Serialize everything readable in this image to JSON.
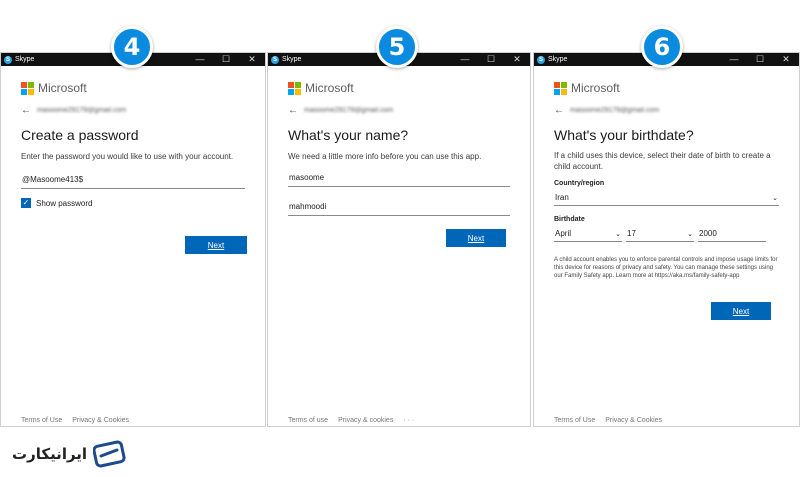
{
  "app": {
    "title": "Skype",
    "logo_letter": "S"
  },
  "window_controls": {
    "minimize": "—",
    "maximize": "☐",
    "close": "✕"
  },
  "brand": {
    "microsoft": "Microsoft",
    "colors": [
      "#f25022",
      "#7fba00",
      "#00a4ef",
      "#ffb900"
    ]
  },
  "email": "masoome29179@gmail.com",
  "steps": [
    "4",
    "5",
    "6"
  ],
  "panel1": {
    "heading": "Create a password",
    "description": "Enter the password you would like to use with your account.",
    "password_value": "@Masoome413$",
    "show_password_label": "Show password",
    "next_label": "Next",
    "footer": {
      "terms": "Terms of Use",
      "privacy": "Privacy & Cookies"
    }
  },
  "panel2": {
    "heading": "What's your name?",
    "description": "We need a little more info before you can use this app.",
    "first_name": "masoome",
    "last_name": "mahmoodi",
    "next_label": "Next",
    "footer": {
      "terms": "Terms of use",
      "privacy": "Privacy & cookies",
      "more": "· · ·"
    }
  },
  "panel3": {
    "heading": "What's your birthdate?",
    "description": "If a child uses this device, select their date of birth to create a child account.",
    "country_label": "Country/region",
    "country_value": "Iran",
    "birthdate_label": "Birthdate",
    "month": "April",
    "day": "17",
    "year": "2000",
    "fineprint": "A child account enables you to enforce parental controls and impose usage limits for this device for reasons of privacy and safety. You can manage these settings using our Family Safety app. Learn more at https://aka.ms/family-safety-app",
    "next_label": "Next",
    "footer": {
      "terms": "Terms of Use",
      "privacy": "Privacy & Cookies"
    }
  },
  "watermark": {
    "text": "ایرانیکارت"
  },
  "accent_color": "#0067b8",
  "badge_color": "#0a8be0"
}
